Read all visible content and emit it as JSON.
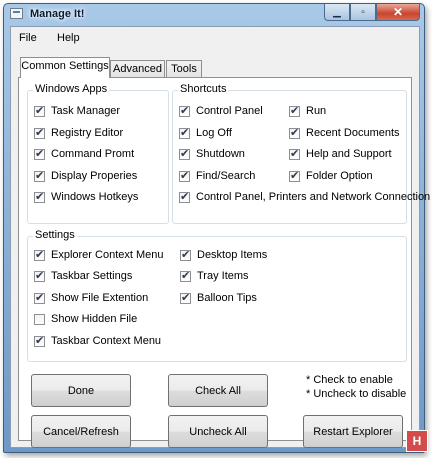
{
  "window": {
    "title": "Manage It!",
    "min_glyph": "▁",
    "max_glyph": "▫",
    "close_glyph": "✕"
  },
  "menu": [
    "File",
    "Help"
  ],
  "tabs": [
    "Common Settings",
    "Advanced",
    "Tools"
  ],
  "windows_apps": {
    "legend": "Windows Apps",
    "items": [
      {
        "label": "Task Manager",
        "checked": true
      },
      {
        "label": "Registry Editor",
        "checked": true
      },
      {
        "label": "Command Promt",
        "checked": true
      },
      {
        "label": "Display Properies",
        "checked": true
      },
      {
        "label": "Windows Hotkeys",
        "checked": true
      }
    ]
  },
  "shortcuts": {
    "legend": "Shortcuts",
    "items": [
      {
        "label": "Control Panel",
        "checked": true
      },
      {
        "label": "Log Off",
        "checked": true
      },
      {
        "label": "Shutdown",
        "checked": true
      },
      {
        "label": "Find/Search",
        "checked": true
      },
      {
        "label": "Run",
        "checked": true
      },
      {
        "label": "Recent Documents",
        "checked": true
      },
      {
        "label": "Help and Support",
        "checked": true
      },
      {
        "label": "Folder Option",
        "checked": true
      },
      {
        "label": "Control Panel, Printers and Network Connection",
        "checked": true
      }
    ]
  },
  "settings": {
    "legend": "Settings",
    "items": [
      {
        "label": "Explorer Context Menu",
        "checked": true
      },
      {
        "label": "Taskbar Settings",
        "checked": true
      },
      {
        "label": "Show File Extention",
        "checked": true
      },
      {
        "label": "Show Hidden File",
        "checked": false
      },
      {
        "label": "Taskbar Context Menu",
        "checked": true
      },
      {
        "label": "Desktop Items",
        "checked": true
      },
      {
        "label": "Tray Items",
        "checked": true
      },
      {
        "label": "Balloon Tips",
        "checked": true
      }
    ]
  },
  "buttons": {
    "done": "Done",
    "check_all": "Check All",
    "cancel_refresh": "Cancel/Refresh",
    "uncheck_all": "Uncheck All",
    "restart_explorer": "Restart Explorer"
  },
  "notes": [
    "* Check to enable",
    "* Uncheck to disable"
  ],
  "badge": "H"
}
